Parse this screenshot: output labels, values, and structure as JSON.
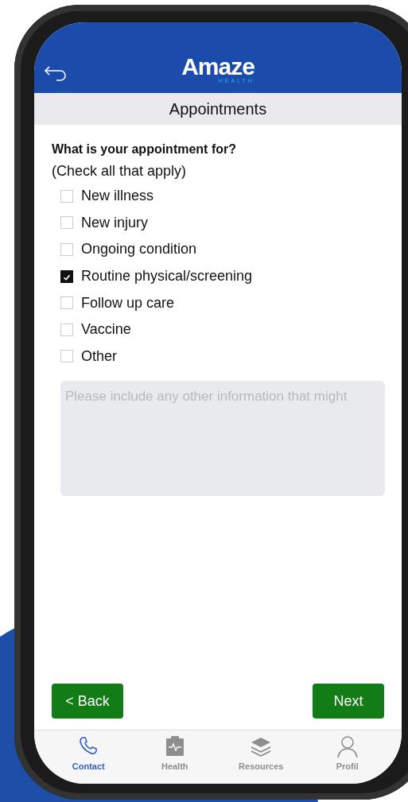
{
  "header": {
    "logo": {
      "word": "Amaze",
      "subword": "HEALTH"
    }
  },
  "title": "Appointments",
  "question": "What is your appointment for?",
  "hint": "(Check all that apply)",
  "options": [
    {
      "label": "New illness",
      "checked": false
    },
    {
      "label": "New injury",
      "checked": false
    },
    {
      "label": "Ongoing condition",
      "checked": false
    },
    {
      "label": "Routine physical/screening",
      "checked": true
    },
    {
      "label": "Follow up care",
      "checked": false
    },
    {
      "label": "Vaccine",
      "checked": false
    },
    {
      "label": "Other",
      "checked": false
    }
  ],
  "notes": {
    "placeholder": "Please include any other information that might"
  },
  "buttons": [
    {
      "label": "< Back"
    },
    {
      "label": "Next"
    }
  ],
  "tab_bar": [
    {
      "label": "Contact",
      "selected": true
    },
    {
      "label": "Health",
      "selected": false
    },
    {
      "label": "Resources",
      "selected": false
    },
    {
      "label": "Profil",
      "selected": false
    }
  ]
}
